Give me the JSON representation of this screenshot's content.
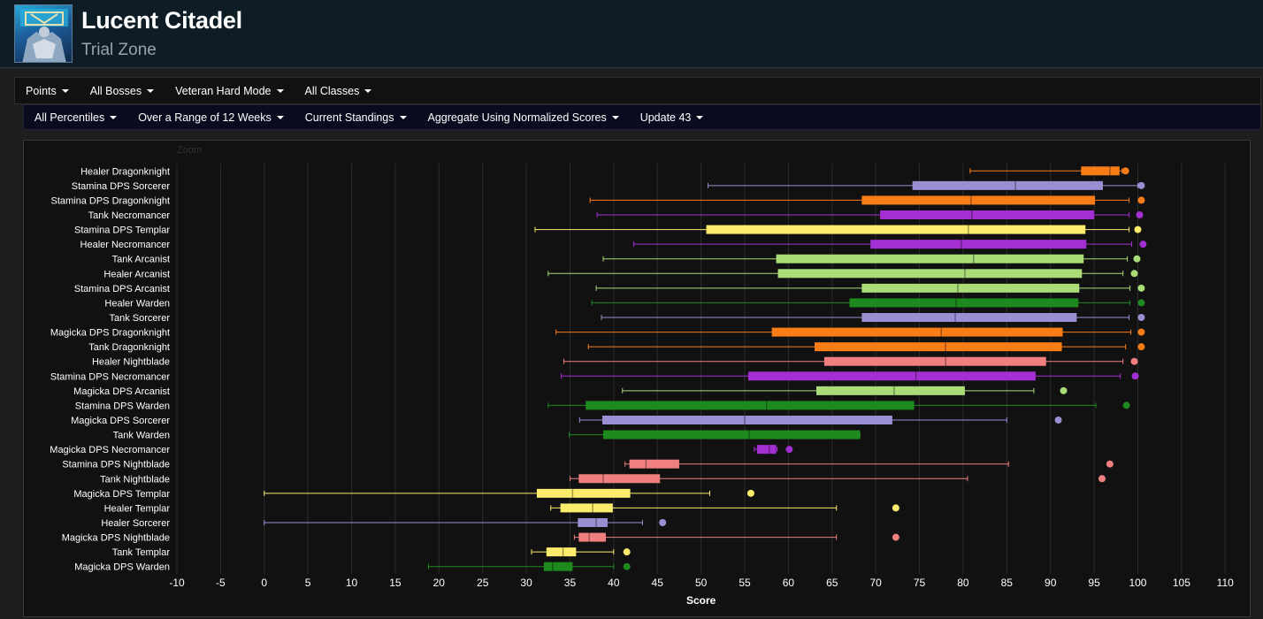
{
  "header": {
    "title": "Lucent Citadel",
    "subtitle": "Trial Zone",
    "logo_icon": "raid-emblem-icon"
  },
  "filters_primary": [
    {
      "label": "Points"
    },
    {
      "label": "All Bosses"
    },
    {
      "label": "Veteran Hard Mode"
    },
    {
      "label": "All Classes"
    }
  ],
  "filters_secondary": [
    {
      "label": "All Percentiles"
    },
    {
      "label": "Over a Range of 12 Weeks"
    },
    {
      "label": "Current Standings"
    },
    {
      "label": "Aggregate Using Normalized Scores"
    },
    {
      "label": "Update 43"
    }
  ],
  "zoom_label": "Zoom",
  "colors": {
    "dragonknight": "#f97d16",
    "sorcerer": "#9b8fd4",
    "necromancer": "#a32fd3",
    "templar": "#fcec6c",
    "arcanist": "#aadc78",
    "warden": "#1e8a1e",
    "nightblade": "#f08080"
  },
  "chart_data": {
    "type": "boxplot",
    "orientation": "horizontal",
    "xlabel": "Score",
    "xlim": [
      -10,
      112
    ],
    "xticks": [
      -10,
      -5,
      0,
      5,
      10,
      15,
      20,
      25,
      30,
      35,
      40,
      45,
      50,
      55,
      60,
      65,
      70,
      75,
      80,
      85,
      90,
      95,
      100,
      105,
      110
    ],
    "grid": true,
    "series": [
      {
        "name": "Healer Dragonknight",
        "color_key": "dragonknight",
        "min": 80.8,
        "q1": 93.5,
        "median": 96.8,
        "q3": 97.9,
        "max": 98.2,
        "outliers": [
          98.6
        ]
      },
      {
        "name": "Stamina DPS Sorcerer",
        "color_key": "sorcerer",
        "min": 50.8,
        "q1": 74.2,
        "median": 86.0,
        "q3": 96.0,
        "max": 100.0,
        "outliers": [
          100.4
        ]
      },
      {
        "name": "Stamina DPS Dragonknight",
        "color_key": "dragonknight",
        "min": 37.3,
        "q1": 68.4,
        "median": 80.9,
        "q3": 95.1,
        "max": 99.0,
        "outliers": [
          100.4
        ]
      },
      {
        "name": "Tank Necromancer",
        "color_key": "necromancer",
        "min": 38.1,
        "q1": 70.5,
        "median": 81.0,
        "q3": 95.0,
        "max": 99.0,
        "outliers": [
          100.2
        ]
      },
      {
        "name": "Stamina DPS Templar",
        "color_key": "templar",
        "min": 31.0,
        "q1": 50.6,
        "median": 80.6,
        "q3": 94.0,
        "max": 99.0,
        "outliers": [
          100.0
        ]
      },
      {
        "name": "Healer Necromancer",
        "color_key": "necromancer",
        "min": 42.3,
        "q1": 69.4,
        "median": 79.8,
        "q3": 94.1,
        "max": 99.3,
        "outliers": [
          100.6
        ]
      },
      {
        "name": "Tank Arcanist",
        "color_key": "arcanist",
        "min": 38.8,
        "q1": 58.6,
        "median": 81.2,
        "q3": 93.8,
        "max": 98.8,
        "outliers": [
          99.9
        ]
      },
      {
        "name": "Healer Arcanist",
        "color_key": "arcanist",
        "min": 32.5,
        "q1": 58.8,
        "median": 80.2,
        "q3": 93.6,
        "max": 98.3,
        "outliers": [
          99.6
        ]
      },
      {
        "name": "Stamina DPS Arcanist",
        "color_key": "arcanist",
        "min": 38.0,
        "q1": 68.4,
        "median": 79.4,
        "q3": 93.3,
        "max": 99.1,
        "outliers": [
          100.4
        ]
      },
      {
        "name": "Healer Warden",
        "color_key": "warden",
        "min": 37.5,
        "q1": 67.0,
        "median": 79.2,
        "q3": 93.2,
        "max": 99.1,
        "outliers": [
          100.4
        ]
      },
      {
        "name": "Tank Sorcerer",
        "color_key": "sorcerer",
        "min": 38.6,
        "q1": 68.4,
        "median": 79.1,
        "q3": 93.0,
        "max": 99.0,
        "outliers": [
          100.4
        ]
      },
      {
        "name": "Magicka DPS Dragonknight",
        "color_key": "dragonknight",
        "min": 33.4,
        "q1": 58.1,
        "median": 77.5,
        "q3": 91.4,
        "max": 99.2,
        "outliers": [
          100.4
        ]
      },
      {
        "name": "Tank Dragonknight",
        "color_key": "dragonknight",
        "min": 37.1,
        "q1": 63.0,
        "median": 78.0,
        "q3": 91.3,
        "max": 98.6,
        "outliers": [
          100.4
        ]
      },
      {
        "name": "Healer Nightblade",
        "color_key": "nightblade",
        "min": 34.3,
        "q1": 64.1,
        "median": 78.0,
        "q3": 89.5,
        "max": 98.3,
        "outliers": [
          99.6
        ]
      },
      {
        "name": "Stamina DPS Necromancer",
        "color_key": "necromancer",
        "min": 34.0,
        "q1": 55.4,
        "median": 74.6,
        "q3": 88.3,
        "max": 98.0,
        "outliers": [
          99.7
        ]
      },
      {
        "name": "Magicka DPS Arcanist",
        "color_key": "arcanist",
        "min": 41.0,
        "q1": 63.2,
        "median": 72.1,
        "q3": 80.2,
        "max": 88.1,
        "outliers": [
          91.5
        ]
      },
      {
        "name": "Stamina DPS Warden",
        "color_key": "warden",
        "min": 32.5,
        "q1": 36.8,
        "median": 57.5,
        "q3": 74.4,
        "max": 95.2,
        "outliers": [
          98.7
        ]
      },
      {
        "name": "Magicka DPS Sorcerer",
        "color_key": "sorcerer",
        "min": 36.1,
        "q1": 38.7,
        "median": 55.0,
        "q3": 71.9,
        "max": 85.0,
        "outliers": [
          90.9
        ]
      },
      {
        "name": "Tank Warden",
        "color_key": "warden",
        "min": 34.9,
        "q1": 38.8,
        "median": 55.5,
        "q3": 68.2,
        "max": 68.2,
        "outliers": []
      },
      {
        "name": "Magicka DPS Necromancer",
        "color_key": "necromancer",
        "min": 56.1,
        "q1": 56.4,
        "median": 57.8,
        "q3": 58.6,
        "max": 58.7,
        "outliers": [
          60.1
        ]
      },
      {
        "name": "Stamina DPS Nightblade",
        "color_key": "nightblade",
        "min": 41.3,
        "q1": 41.8,
        "median": 43.7,
        "q3": 47.5,
        "max": 85.2,
        "outliers": [
          96.8
        ]
      },
      {
        "name": "Tank Nightblade",
        "color_key": "nightblade",
        "min": 35.0,
        "q1": 36.0,
        "median": 38.8,
        "q3": 45.3,
        "max": 80.5,
        "outliers": [
          95.9
        ]
      },
      {
        "name": "Magicka DPS Templar",
        "color_key": "templar",
        "min": 0.0,
        "q1": 31.2,
        "median": 35.3,
        "q3": 41.9,
        "max": 51.0,
        "outliers": [
          55.7
        ]
      },
      {
        "name": "Healer Templar",
        "color_key": "templar",
        "min": 32.8,
        "q1": 33.9,
        "median": 37.6,
        "q3": 39.9,
        "max": 65.5,
        "outliers": [
          72.3
        ]
      },
      {
        "name": "Healer Sorcerer",
        "color_key": "sorcerer",
        "min": 0.0,
        "q1": 35.9,
        "median": 38.0,
        "q3": 39.3,
        "max": 43.3,
        "outliers": [
          45.6
        ]
      },
      {
        "name": "Magicka DPS Nightblade",
        "color_key": "nightblade",
        "min": 35.5,
        "q1": 36.0,
        "median": 37.2,
        "q3": 39.1,
        "max": 65.5,
        "outliers": [
          72.3
        ]
      },
      {
        "name": "Tank Templar",
        "color_key": "templar",
        "min": 30.6,
        "q1": 32.3,
        "median": 34.2,
        "q3": 35.7,
        "max": 40.0,
        "outliers": [
          41.5
        ]
      },
      {
        "name": "Magicka DPS Warden",
        "color_key": "warden",
        "min": 18.8,
        "q1": 32.0,
        "median": 33.0,
        "q3": 35.3,
        "max": 40.0,
        "outliers": [
          41.5
        ]
      }
    ]
  }
}
